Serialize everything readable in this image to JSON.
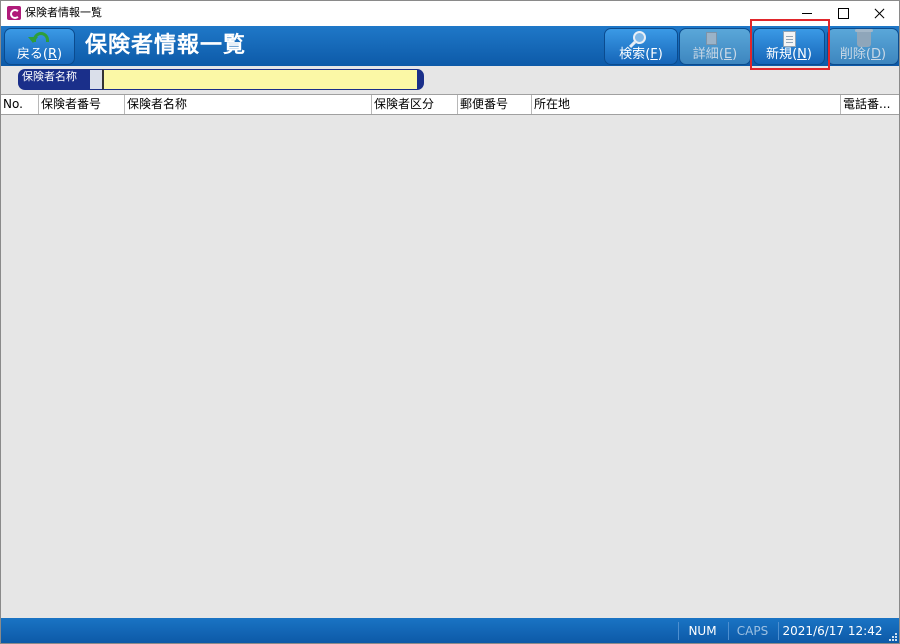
{
  "window": {
    "title": "保険者情報一覧"
  },
  "header": {
    "back_label": "戻る",
    "back_key": "R",
    "page_title": "保険者情報一覧",
    "buttons": {
      "search": {
        "label": "検索",
        "key": "F",
        "enabled": true
      },
      "detail": {
        "label": "詳細",
        "key": "E",
        "enabled": false
      },
      "new": {
        "label": "新規",
        "key": "N",
        "enabled": true,
        "highlighted": true
      },
      "delete": {
        "label": "削除",
        "key": "D",
        "enabled": false
      }
    }
  },
  "filter": {
    "label": "保険者名称",
    "value": ""
  },
  "table": {
    "columns": [
      "No.",
      "保険者番号",
      "保険者名称",
      "保険者区分",
      "郵便番号",
      "所在地",
      "電話番..."
    ],
    "rows": []
  },
  "statusbar": {
    "num": "NUM",
    "caps": "CAPS",
    "datetime": "2021/6/17 12:42"
  },
  "colors": {
    "header_blue": "#0d5aa8",
    "filter_yellow": "#fbf8a6",
    "highlight_red": "#e0262b",
    "app_icon": "#b01a7a"
  }
}
